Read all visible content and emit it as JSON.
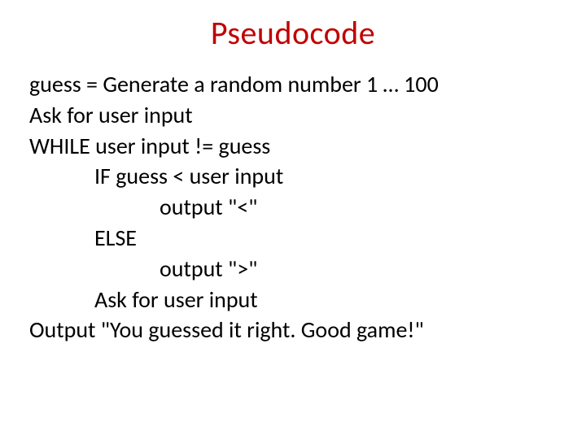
{
  "title": "Pseudocode",
  "lines": {
    "l0": "guess = Generate a random number 1 … 100",
    "l1": "Ask for user input",
    "l2": "WHILE user input != guess",
    "l3": "IF guess < user input",
    "l4": "output \"<\"",
    "l5": "ELSE",
    "l6": "output \">\"",
    "l7": "Ask for user input",
    "l8": "Output \"You guessed it right. Good game!\""
  }
}
